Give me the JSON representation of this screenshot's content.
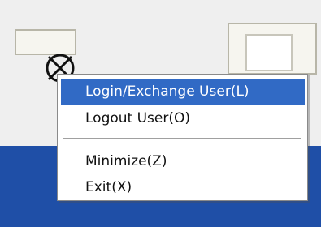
{
  "context_menu": {
    "items": [
      {
        "label": "Login/Exchange User(L)",
        "highlighted": true
      },
      {
        "label": "Logout User(O)",
        "highlighted": false
      },
      {
        "label": "Minimize(Z)",
        "highlighted": false
      },
      {
        "label": "Exit(X)",
        "highlighted": false
      }
    ]
  },
  "tray_icon": {
    "name": "app-tray-icon"
  },
  "colors": {
    "menu_highlight": "#316ac5",
    "menu_background": "#ffffff",
    "taskbar": "#1f4fa7",
    "desktop": "#efefef"
  }
}
